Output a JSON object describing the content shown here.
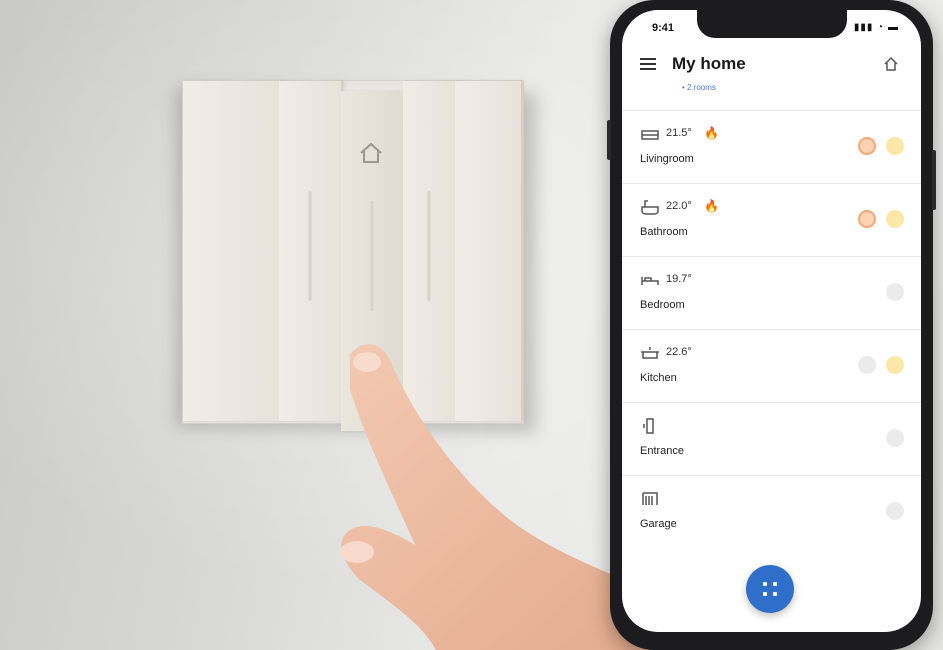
{
  "phone": {
    "status_time": "9:41",
    "app_title": "My home",
    "app_subtitle": "• 2 rooms",
    "rooms": [
      {
        "name": "Livingroom",
        "temp": "21.5°",
        "icon": "sofa-icon",
        "heating": true,
        "controls": [
          "warm",
          "light"
        ]
      },
      {
        "name": "Bathroom",
        "temp": "22.0°",
        "icon": "bathtub-icon",
        "heating": true,
        "controls": [
          "warm",
          "light"
        ]
      },
      {
        "name": "Bedroom",
        "temp": "19.7°",
        "icon": "bed-icon",
        "heating": false,
        "controls": [
          "off"
        ]
      },
      {
        "name": "Kitchen",
        "temp": "22.6°",
        "icon": "pot-icon",
        "heating": false,
        "controls": [
          "off",
          "light"
        ]
      },
      {
        "name": "Entrance",
        "temp": "",
        "icon": "door-icon",
        "heating": false,
        "controls": [
          "off"
        ]
      },
      {
        "name": "Garage",
        "temp": "",
        "icon": "garage-icon",
        "heating": false,
        "controls": [
          "off"
        ]
      }
    ],
    "fab_icon": "grid-icon",
    "accent": "#2f6fc9"
  },
  "switch_plate": {
    "rockers": 4,
    "pressed_rocker": 2,
    "color": "#ece8e1"
  }
}
